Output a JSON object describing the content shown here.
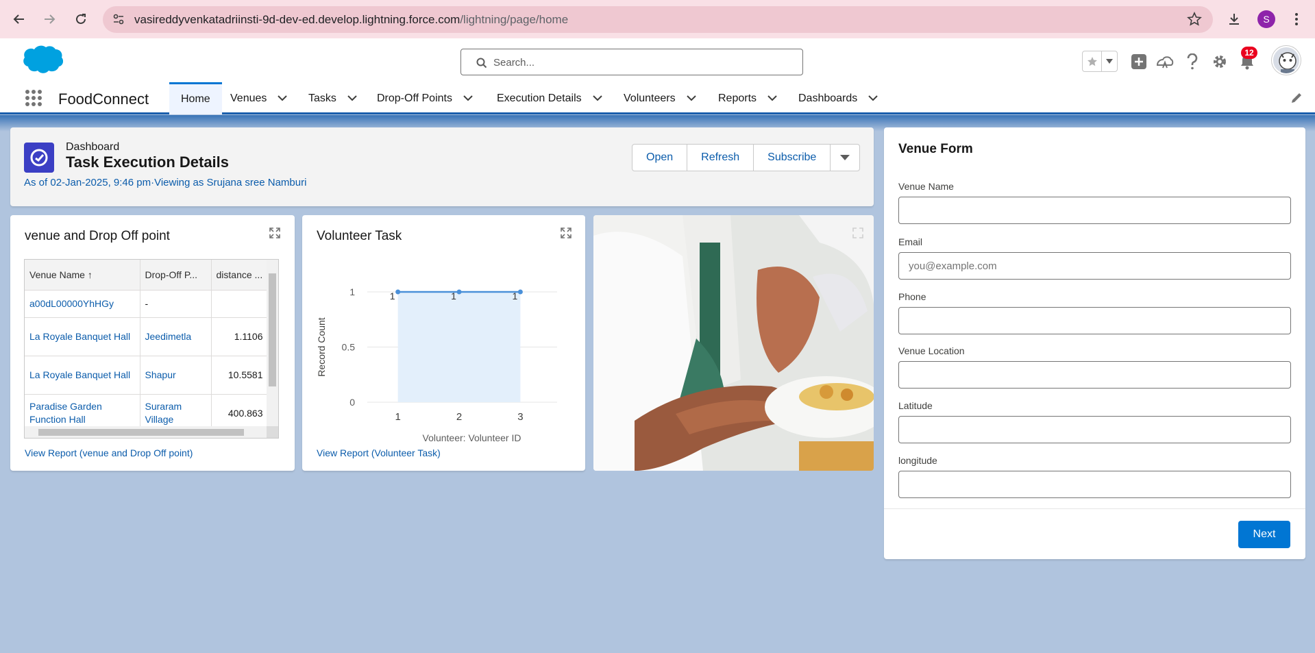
{
  "browser": {
    "url_host": "vasireddyvenkatadriinsti-9d-dev-ed.develop.lightning.force.com",
    "url_path": "/lightning/page/home",
    "profile_initial": "S"
  },
  "header": {
    "search_placeholder": "Search...",
    "notification_count": "12"
  },
  "nav": {
    "app_name": "FoodConnect",
    "items": [
      {
        "label": "Home"
      },
      {
        "label": "Venues"
      },
      {
        "label": "Tasks"
      },
      {
        "label": "Drop-Off Points"
      },
      {
        "label": "Execution Details"
      },
      {
        "label": "Volunteers"
      },
      {
        "label": "Reports"
      },
      {
        "label": "Dashboards"
      }
    ]
  },
  "dashboard": {
    "type_label": "Dashboard",
    "title": "Task Execution Details",
    "meta": "As of 02-Jan-2025, 9:46 pm·Viewing as Srujana sree Namburi",
    "buttons": {
      "open": "Open",
      "refresh": "Refresh",
      "subscribe": "Subscribe"
    }
  },
  "venue_widget": {
    "title": "venue and Drop Off point",
    "columns": [
      "Venue Name",
      "Drop-Off P...",
      "distance ..."
    ],
    "rows": [
      {
        "venue": "a00dL00000YhHGy",
        "dropoff": "-",
        "distance": ""
      },
      {
        "venue": "La Royale Banquet Hall",
        "dropoff": "Jeedimetla",
        "distance": "1.1106"
      },
      {
        "venue": "La Royale Banquet Hall",
        "dropoff": "Shapur",
        "distance": "10.5581"
      },
      {
        "venue": "Paradise Garden Function Hall",
        "dropoff": "Suraram Village",
        "distance": "400.863"
      }
    ],
    "link": "View Report (venue and Drop Off point)"
  },
  "volunteer_widget": {
    "title": "Volunteer Task",
    "link": "View Report (Volunteer Task)"
  },
  "chart_data": {
    "type": "area",
    "title": "Volunteer Task",
    "x": [
      1,
      2,
      3
    ],
    "xlabel": "Volunteer: Volunteer ID",
    "ylabel": "Record Count",
    "values": [
      1,
      1,
      1
    ],
    "data_labels": [
      "1",
      "1",
      "1"
    ],
    "y_ticks": [
      "0",
      "0.5",
      "1"
    ],
    "x_ticks": [
      "1",
      "2",
      "3"
    ],
    "ylim": [
      0,
      1
    ],
    "grid": true,
    "colors": {
      "line": "#4a90d9",
      "fill": "#e3effb"
    }
  },
  "venue_form": {
    "title": "Venue Form",
    "fields": [
      {
        "label": "Venue Name",
        "placeholder": ""
      },
      {
        "label": "Email",
        "placeholder": "you@example.com"
      },
      {
        "label": "Phone",
        "placeholder": ""
      },
      {
        "label": "Venue Location",
        "placeholder": ""
      },
      {
        "label": "Latitude",
        "placeholder": ""
      },
      {
        "label": "longitude",
        "placeholder": ""
      }
    ],
    "next_label": "Next"
  }
}
